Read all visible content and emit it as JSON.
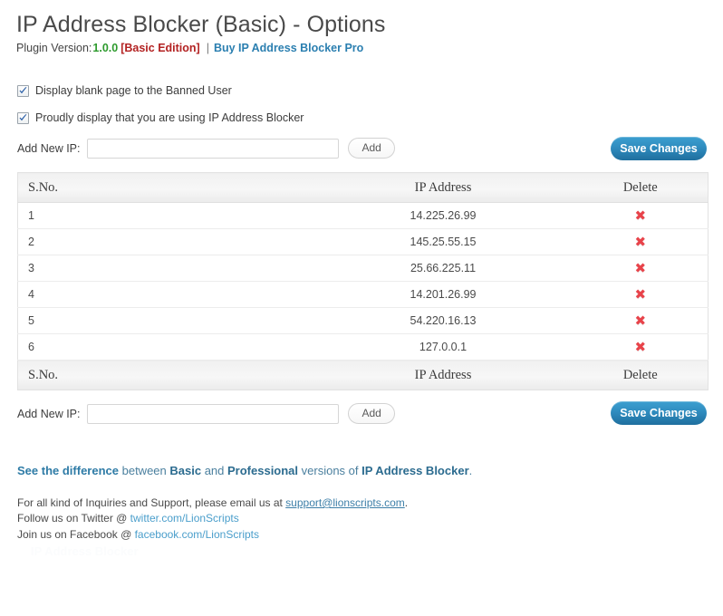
{
  "header": {
    "title": "IP Address Blocker (Basic) - Options",
    "version_label": "Plugin Version:",
    "version_number": "1.0.0",
    "edition": "[Basic Edition]",
    "separator": "|",
    "pro_link": "Buy IP Address Blocker Pro"
  },
  "options": {
    "checkbox_1": "Display blank page to the Banned User",
    "checkbox_1_checked": true,
    "checkbox_2": "Proudly display that you are using IP Address Blocker",
    "checkbox_2_checked": true
  },
  "add_ip_top": {
    "label": "Add New IP:",
    "value": "",
    "placeholder": "",
    "add_button": "Add",
    "save_button": "Save Changes"
  },
  "add_ip_bottom": {
    "label": "Add New IP:",
    "value": "",
    "placeholder": "",
    "add_button": "Add",
    "save_button": "Save Changes"
  },
  "table": {
    "columns": [
      "S.No.",
      "IP Address",
      "Delete"
    ],
    "delete_icon": "✖",
    "rows": [
      {
        "sno": "1",
        "ip": "14.225.26.99"
      },
      {
        "sno": "2",
        "ip": "145.25.55.15"
      },
      {
        "sno": "3",
        "ip": "25.66.225.11"
      },
      {
        "sno": "4",
        "ip": "14.201.26.99"
      },
      {
        "sno": "5",
        "ip": "54.220.16.13"
      },
      {
        "sno": "6",
        "ip": "127.0.0.1"
      }
    ]
  },
  "footer": {
    "diff_link": "See the difference",
    "diff_mid1": " between ",
    "diff_basic": "Basic",
    "diff_mid2": " and ",
    "diff_pro": "Professional",
    "diff_mid3": " versions of ",
    "diff_product": "IP Address Blocker",
    "diff_end": ".",
    "support_text": "For all kind of Inquiries and Support, please email us at ",
    "support_email": "support@lionscripts.com",
    "support_period": ".",
    "twitter_text": "Follow us on Twitter @ ",
    "twitter_link": "twitter.com/LionScripts",
    "facebook_text": "Join us on Facebook @ ",
    "facebook_link": "facebook.com/LionScripts",
    "ghost_text": "IP Address Blocker"
  },
  "colors": {
    "accent_blue": "#2b7fb0",
    "version_green": "#2e9b2e",
    "edition_red": "#b32222",
    "delete_red": "#e8434a",
    "save_button": "#2f8cbf"
  }
}
